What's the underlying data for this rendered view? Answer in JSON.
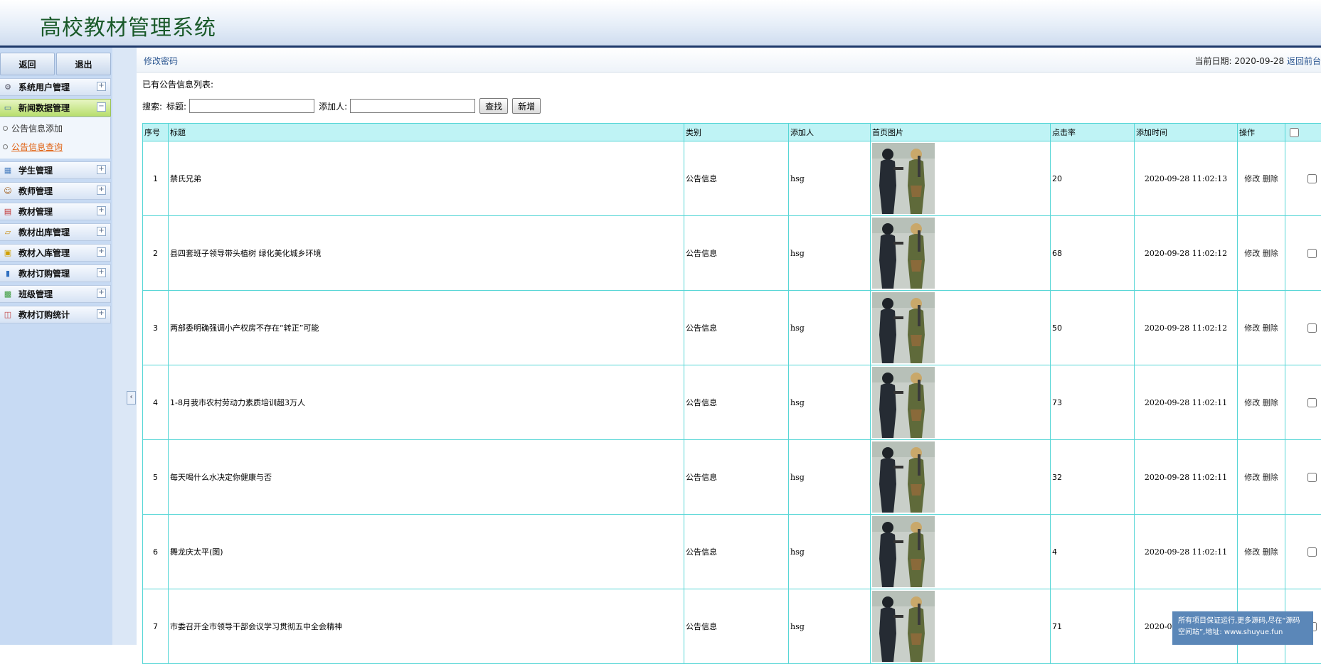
{
  "app": {
    "title": "高校教材管理系统"
  },
  "sidebar": {
    "back_label": "返回",
    "logout_label": "退出",
    "menu": [
      {
        "label": "系统用户管理",
        "icon": "gear-icon",
        "expanded": false
      },
      {
        "label": "新闻数据管理",
        "icon": "monitor-icon",
        "expanded": true,
        "children": [
          {
            "label": "公告信息添加",
            "current": false
          },
          {
            "label": "公告信息查询",
            "current": true
          }
        ]
      },
      {
        "label": "学生管理",
        "icon": "table-icon",
        "expanded": false
      },
      {
        "label": "教师管理",
        "icon": "users-icon",
        "expanded": false
      },
      {
        "label": "教材管理",
        "icon": "calendar-icon",
        "expanded": false
      },
      {
        "label": "教材出库管理",
        "icon": "folder-icon",
        "expanded": false
      },
      {
        "label": "教材入库管理",
        "icon": "lock-icon",
        "expanded": false
      },
      {
        "label": "教材订购管理",
        "icon": "bar-chart-icon",
        "expanded": false
      },
      {
        "label": "班级管理",
        "icon": "class-icon",
        "expanded": false
      },
      {
        "label": "教材订购统计",
        "icon": "stats-icon",
        "expanded": false
      }
    ]
  },
  "topbar": {
    "change_password": "修改密码",
    "date_label": "当前日期:",
    "date": "2020-09-28",
    "home_link": "返回前台"
  },
  "list": {
    "caption": "已有公告信息列表:",
    "search_label": "搜索:",
    "title_label": "标题:",
    "title_value": "",
    "adder_label": "添加人:",
    "adder_value": "",
    "find_button": "查找",
    "add_button": "新增"
  },
  "table": {
    "headers": [
      "序号",
      "标题",
      "类别",
      "添加人",
      "首页图片",
      "点击率",
      "添加时间",
      "操作"
    ],
    "edit_label": "修改",
    "delete_label": "删除",
    "rows": [
      {
        "no": "1",
        "title": "禁氏兄弟",
        "category": "公告信息",
        "adder": "hsg",
        "clicks": "20",
        "time": "2020-09-28 11:02:13"
      },
      {
        "no": "2",
        "title": "县四套班子领导带头植树 绿化美化城乡环境",
        "category": "公告信息",
        "adder": "hsg",
        "clicks": "68",
        "time": "2020-09-28 11:02:12"
      },
      {
        "no": "3",
        "title": "两部委明确强调小产权房不存在“转正”可能",
        "category": "公告信息",
        "adder": "hsg",
        "clicks": "50",
        "time": "2020-09-28 11:02:12"
      },
      {
        "no": "4",
        "title": "1-8月我市农村劳动力素质培训超3万人",
        "category": "公告信息",
        "adder": "hsg",
        "clicks": "73",
        "time": "2020-09-28 11:02:11"
      },
      {
        "no": "5",
        "title": "每天喝什么水决定你健康与否",
        "category": "公告信息",
        "adder": "hsg",
        "clicks": "32",
        "time": "2020-09-28 11:02:11"
      },
      {
        "no": "6",
        "title": "舞龙庆太平(图)",
        "category": "公告信息",
        "adder": "hsg",
        "clicks": "4",
        "time": "2020-09-28 11:02:11"
      },
      {
        "no": "7",
        "title": "市委召开全市领导干部会议学习贯彻五中全会精神",
        "category": "公告信息",
        "adder": "hsg",
        "clicks": "71",
        "time": "2020-09-28 11:02:10"
      }
    ]
  },
  "watermark": {
    "line1": "所有项目保证运行,更多源码,尽在“源码",
    "line2": "空间站”,地址: www.shuyue.fun"
  }
}
